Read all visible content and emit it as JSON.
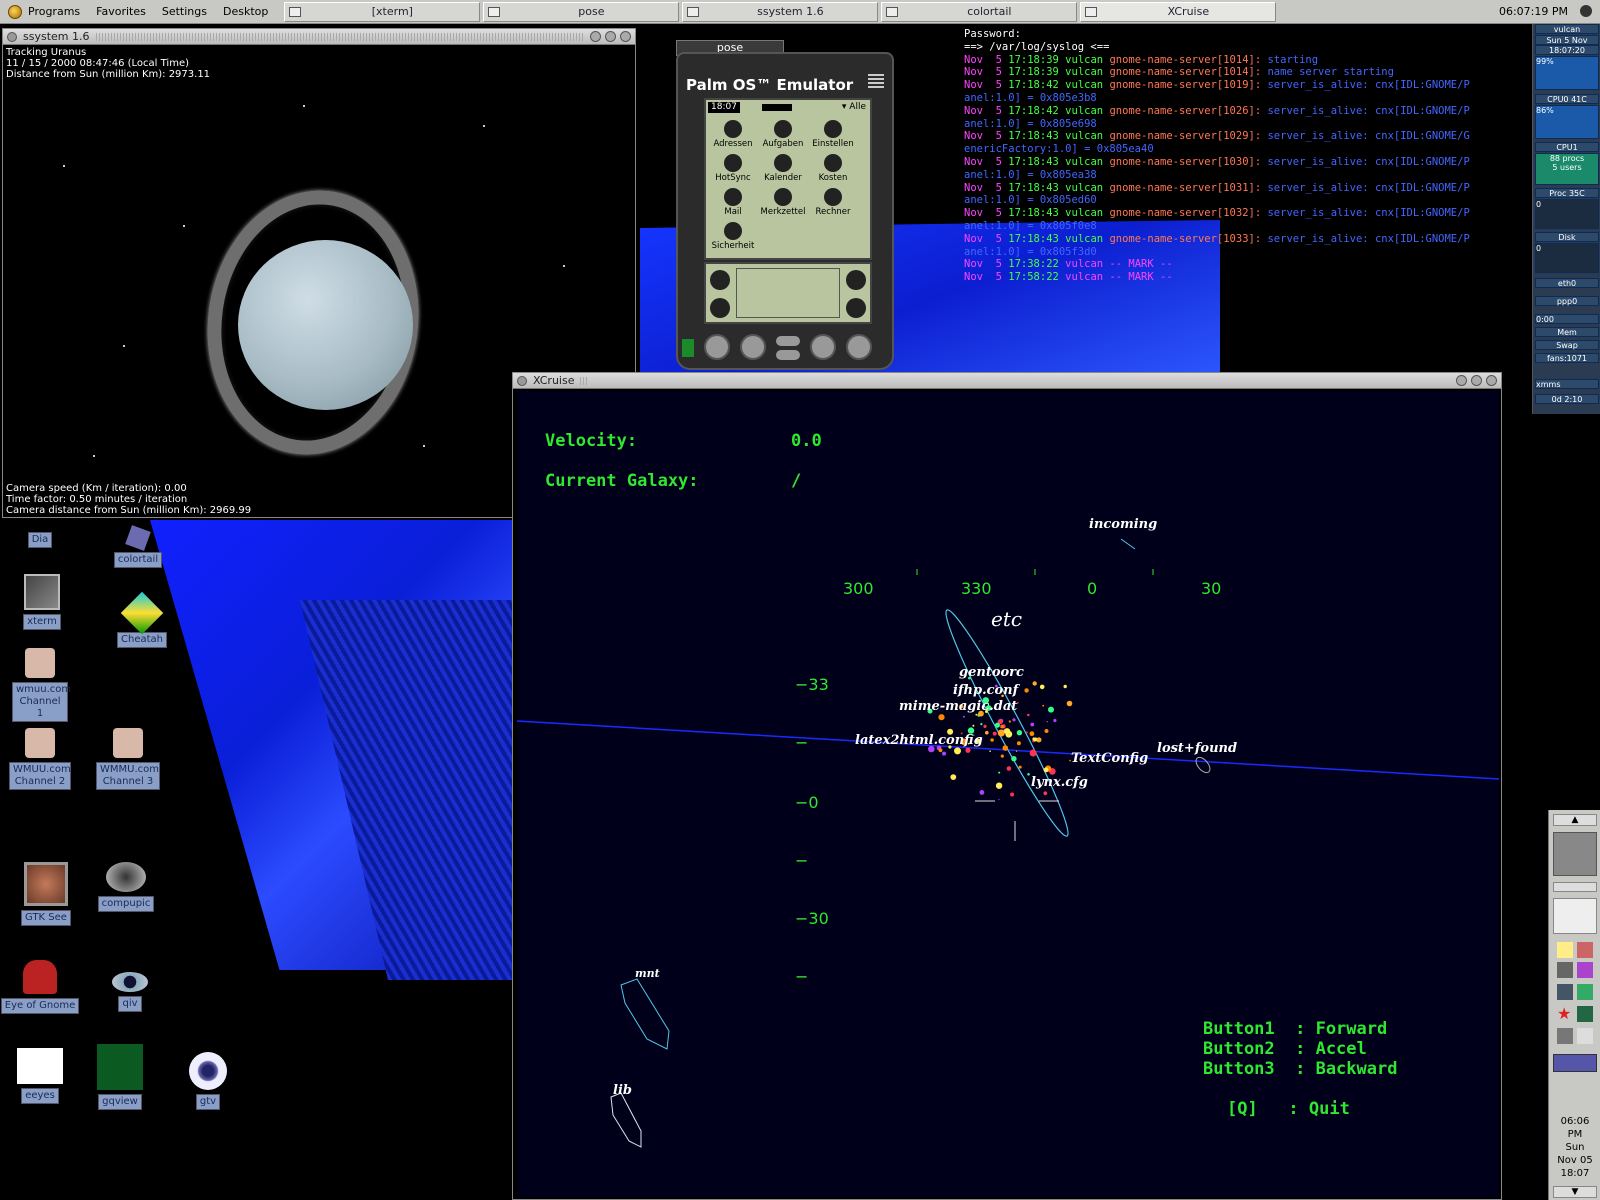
{
  "panel": {
    "menus": [
      "Programs",
      "Favorites",
      "Settings",
      "Desktop"
    ],
    "tasks": [
      "[xterm]",
      "pose",
      "ssystem 1.6",
      "colortail",
      "XCruise"
    ],
    "clock": "06:07:19 PM"
  },
  "ssystem": {
    "title": "ssystem 1.6",
    "line1": "Tracking Uranus",
    "line2": "11 / 15 / 2000  08:47:46 (Local Time)",
    "line3": "Distance from Sun (million Km): 2973.11",
    "bottom1": "Camera speed (Km / iteration): 0.00",
    "bottom2": "Time factor: 0.50 minutes / iteration",
    "bottom3": "Camera distance from Sun (million Km): 2969.99"
  },
  "desktop_icons": {
    "dia": "Dia",
    "colortail": "colortail",
    "xterm": "xterm",
    "cheatah": "Cheatah",
    "wmuu1": "wmuu.com Channel 1",
    "wmuu2": "WMUU.com Channel 2",
    "wmuu3": "WMMU.com Channel 3",
    "gtksee": "GTK See",
    "compupic": "compupic",
    "eog": "Eye of Gnome",
    "qiv": "qiv",
    "xeyes": "eeyes",
    "gqview": "gqview",
    "gtv": "gtv"
  },
  "palm": {
    "tab": "pose",
    "title": "Palm OS™ Emulator",
    "time": "18:07",
    "category": "▾ Alle",
    "apps": [
      "Adressen",
      "Aufgaben",
      "Einstellen",
      "HotSync",
      "Kalender",
      "Kosten",
      "Mail",
      "Merkzettel",
      "Rechner",
      "Sicherheit"
    ]
  },
  "log": {
    "header1": "Password:",
    "header2": "==> /var/log/syslog <==",
    "lines": [
      {
        "date": "Nov  5",
        "time": "17:18:39",
        "host": "vulcan",
        "proc": "gnome-name-server[1014]:",
        "msg": "starting"
      },
      {
        "date": "Nov  5",
        "time": "17:18:39",
        "host": "vulcan",
        "proc": "gnome-name-server[1014]:",
        "msg": "name server starting"
      },
      {
        "date": "Nov  5",
        "time": "17:18:42",
        "host": "vulcan",
        "proc": "gnome-name-server[1019]:",
        "msg": "server_is_alive: cnx[IDL:GNOME/P"
      },
      {
        "cont": "anel:1.0] = 0x805e3b8"
      },
      {
        "date": "Nov  5",
        "time": "17:18:42",
        "host": "vulcan",
        "proc": "gnome-name-server[1026]:",
        "msg": "server_is_alive: cnx[IDL:GNOME/P"
      },
      {
        "cont": "anel:1.0] = 0x805e698"
      },
      {
        "date": "Nov  5",
        "time": "17:18:43",
        "host": "vulcan",
        "proc": "gnome-name-server[1029]:",
        "msg": "server_is_alive: cnx[IDL:GNOME/G"
      },
      {
        "cont": "enericFactory:1.0] = 0x805ea40"
      },
      {
        "date": "Nov  5",
        "time": "17:18:43",
        "host": "vulcan",
        "proc": "gnome-name-server[1030]:",
        "msg": "server_is_alive: cnx[IDL:GNOME/P"
      },
      {
        "cont": "anel:1.0] = 0x805ea38"
      },
      {
        "date": "Nov  5",
        "time": "17:18:43",
        "host": "vulcan",
        "proc": "gnome-name-server[1031]:",
        "msg": "server_is_alive: cnx[IDL:GNOME/P"
      },
      {
        "cont": "anel:1.0] = 0x805ed60"
      },
      {
        "date": "Nov  5",
        "time": "17:18:43",
        "host": "vulcan",
        "proc": "gnome-name-server[1032]:",
        "msg": "server_is_alive: cnx[IDL:GNOME/P"
      },
      {
        "cont": "anel:1.0] = 0x805f0e8"
      },
      {
        "date": "Nov  5",
        "time": "17:18:43",
        "host": "vulcan",
        "proc": "gnome-name-server[1033]:",
        "msg": "server_is_alive: cnx[IDL:GNOME/P"
      },
      {
        "cont": "anel:1.0] = 0x805f3d0"
      },
      {
        "date": "Nov  5",
        "time": "17:38:22",
        "host": "vulcan",
        "proc": "-- MARK --",
        "msg": ""
      },
      {
        "date": "Nov  5",
        "time": "17:58:22",
        "host": "vulcan",
        "proc": "-- MARK --",
        "msg": ""
      }
    ]
  },
  "xcruise": {
    "title": "XCruise",
    "velocity_label": "Velocity:",
    "velocity_value": "0.0",
    "galaxy_label": "Current Galaxy:",
    "galaxy_value": "/",
    "heading_ticks": [
      "300",
      "330",
      "0",
      "30"
    ],
    "pitch_ticks": [
      "−33",
      "−",
      "−0",
      "−",
      "−30",
      "−"
    ],
    "center": "etc",
    "labels": [
      "incoming",
      "gentoorc",
      "ifhp.conf",
      "mime-magic.dat",
      "latex2html.config",
      "TextConfig",
      "lost+found",
      "lynx.cfg",
      "mnt",
      "lib"
    ],
    "help": [
      "Button1  : Forward",
      "Button2  : Accel",
      "Button3  : Backward",
      "[Q]   : Quit"
    ]
  },
  "gkrellm": {
    "host": "vulcan",
    "date": "Sun  5 Nov",
    "time": "18:07:20",
    "pct": "99%",
    "cpu0": "CPU0",
    "cpu0_temp": "41C",
    "cpu0_pct": "86%",
    "cpu1": "CPU1",
    "procs": "88 procs",
    "users": "5 users",
    "proc": "Proc",
    "proc_temp": "35C",
    "disk": "Disk",
    "eth0": "eth0",
    "ppp0": "ppp0",
    "ppp_time": "0:00",
    "mem": "Mem",
    "swap": "Swap",
    "fans": "fans:1071",
    "xmms": "xmms",
    "uptime": "0d 2:10"
  },
  "dock": {
    "time": "06:06",
    "ampm": "PM",
    "day": "Sun",
    "date": "Nov 05",
    "time2": "18:07"
  }
}
